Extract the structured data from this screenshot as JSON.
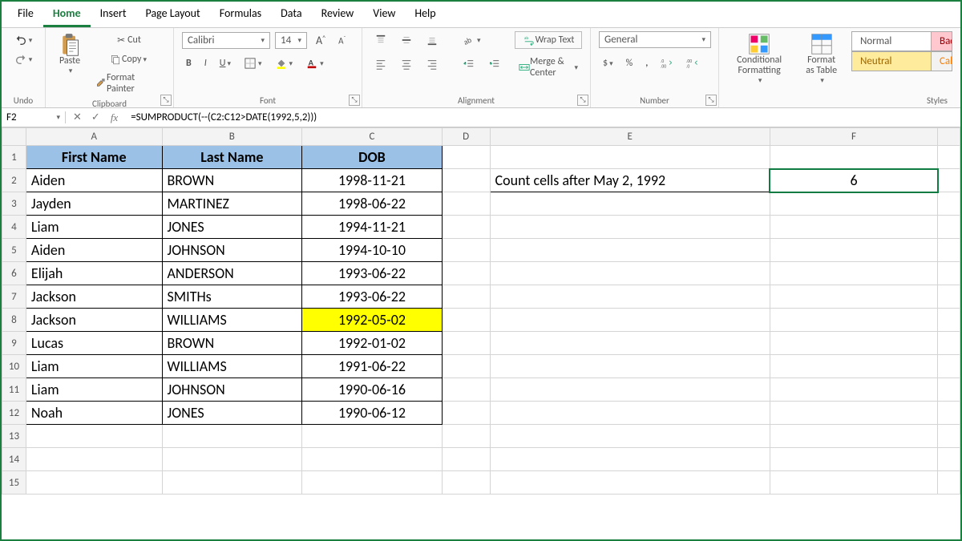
{
  "menu": {
    "tabs": [
      "File",
      "Home",
      "Insert",
      "Page Layout",
      "Formulas",
      "Data",
      "Review",
      "View",
      "Help"
    ],
    "active": "Home"
  },
  "ribbon": {
    "undo": {
      "label": "Undo"
    },
    "clipboard": {
      "paste": "Paste",
      "cut": "Cut",
      "copy": "Copy",
      "format_painter": "Format Painter",
      "label": "Clipboard"
    },
    "font": {
      "name": "Calibri",
      "size": "14",
      "bold": "B",
      "italic": "I",
      "underline": "U",
      "label": "Font"
    },
    "alignment": {
      "wrap": "Wrap Text",
      "merge": "Merge & Center",
      "label": "Alignment"
    },
    "number": {
      "format": "General",
      "currency": "$",
      "percent": "%",
      "comma": ",",
      "label": "Number"
    },
    "styles": {
      "cond": "Conditional Formatting",
      "table": "Format as Table",
      "normal": "Normal",
      "bad": "Bad",
      "neutral": "Neutral",
      "calc": "Cal",
      "label": "Styles"
    }
  },
  "formula_bar": {
    "name_box": "F2",
    "formula": "=SUMPRODUCT(--(C2:C12>DATE(1992,5,2)))"
  },
  "columns": [
    "A",
    "B",
    "C",
    "D",
    "E",
    "F"
  ],
  "headers": {
    "A": "First Name",
    "B": "Last Name",
    "C": "DOB"
  },
  "rows": [
    {
      "n": "1"
    },
    {
      "n": "2",
      "A": "Aiden",
      "B": "BROWN",
      "C": "1998-11-21",
      "E": "Count cells after May 2, 1992",
      "F": "6"
    },
    {
      "n": "3",
      "A": "Jayden",
      "B": "MARTINEZ",
      "C": "1998-06-22"
    },
    {
      "n": "4",
      "A": "Liam",
      "B": "JONES",
      "C": "1994-11-21"
    },
    {
      "n": "5",
      "A": "Aiden",
      "B": "JOHNSON",
      "C": "1994-10-10"
    },
    {
      "n": "6",
      "A": "Elijah",
      "B": "ANDERSON",
      "C": "1993-06-22"
    },
    {
      "n": "7",
      "A": "Jackson",
      "B": "SMITHs",
      "C": "1993-06-22"
    },
    {
      "n": "8",
      "A": "Jackson",
      "B": "WILLIAMS",
      "C": "1992-05-02",
      "hlC": true
    },
    {
      "n": "9",
      "A": "Lucas",
      "B": "BROWN",
      "C": "1992-01-02"
    },
    {
      "n": "10",
      "A": "Liam",
      "B": "WILLIAMS",
      "C": "1991-06-22"
    },
    {
      "n": "11",
      "A": "Liam",
      "B": "JOHNSON",
      "C": "1990-06-16"
    },
    {
      "n": "12",
      "A": "Noah",
      "B": "JONES",
      "C": "1990-06-12"
    },
    {
      "n": "13"
    },
    {
      "n": "14"
    },
    {
      "n": "15"
    }
  ],
  "selected_cell": "F2"
}
